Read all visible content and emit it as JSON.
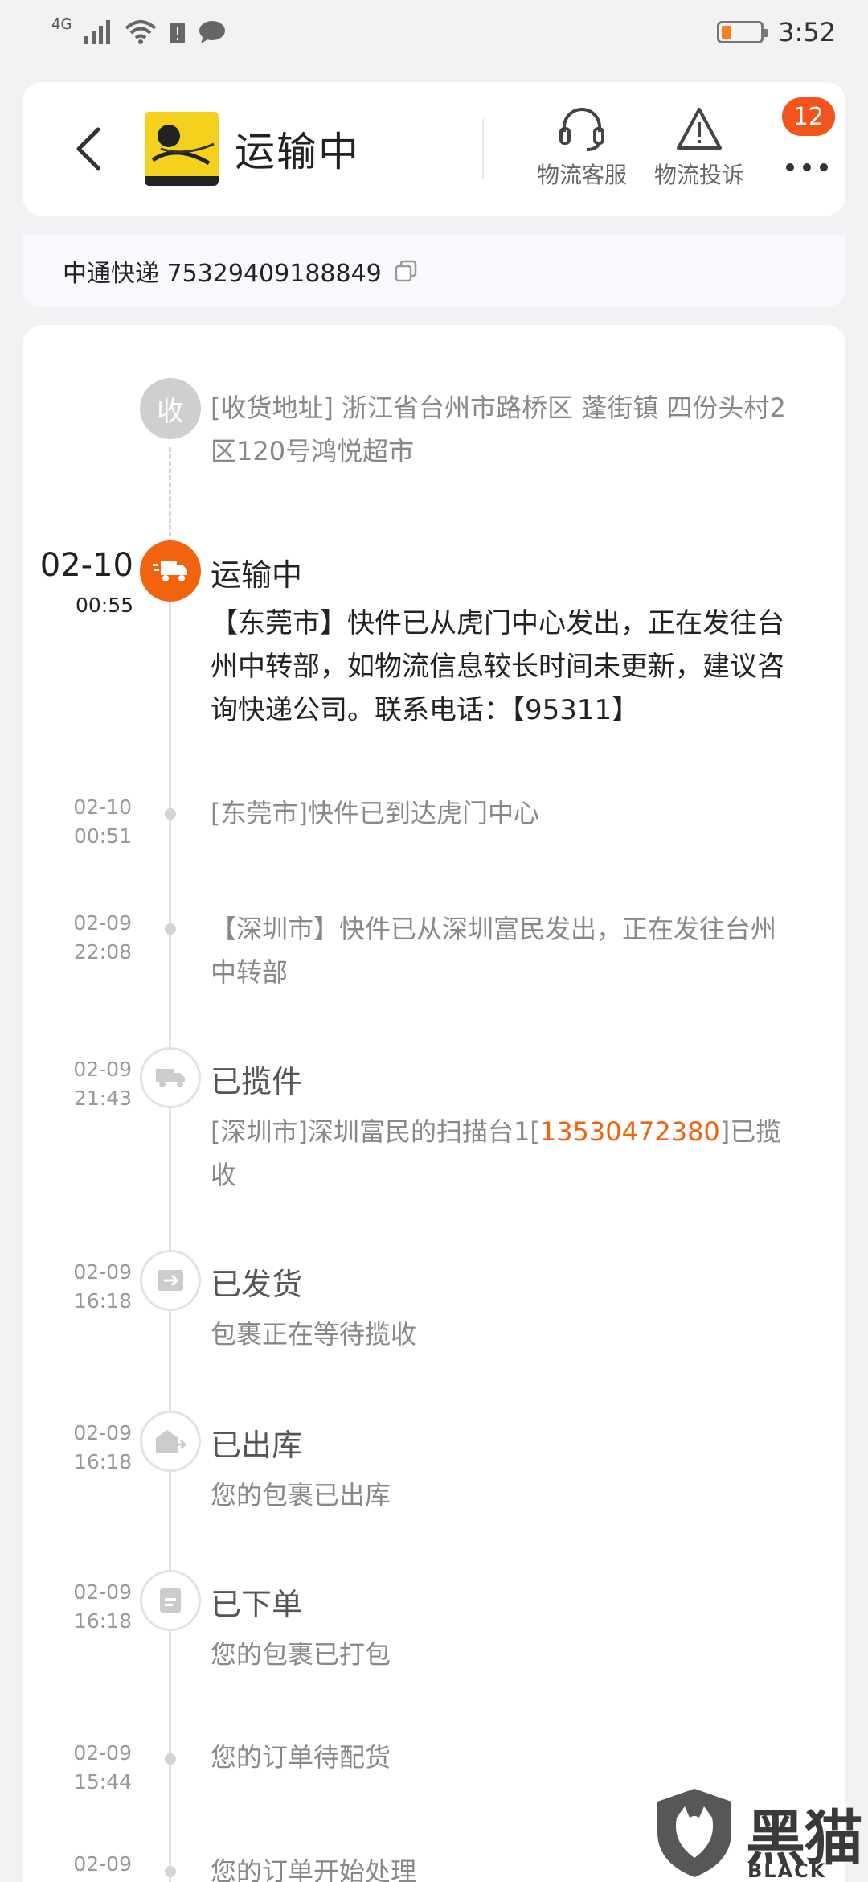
{
  "status_bar": {
    "network": "4G",
    "time": "3:52",
    "battery_level": 0.2
  },
  "header": {
    "title": "运输中",
    "actions": [
      {
        "label": "物流客服",
        "icon": "headset-icon"
      },
      {
        "label": "物流投诉",
        "icon": "warning-icon"
      }
    ],
    "more_badge": "12"
  },
  "courier": {
    "text": "中通快递 75329409188849"
  },
  "timeline": {
    "address": "[收货地址] 浙江省台州市路桥区 蓬街镇   四份头村2区120号鸿悦超市",
    "address_badge": "收",
    "events": [
      {
        "date": "02-10",
        "time": "00:55",
        "title": "运输中",
        "text": "【东莞市】快件已从虎门中心发出，正在发往台州中转部，如物流信息较长时间未更新，建议咨询快递公司。联系电话：【95311】"
      },
      {
        "date": "02-10",
        "time": "00:51",
        "text": "[东莞市]快件已到达虎门中心"
      },
      {
        "date": "02-09",
        "time": "22:08",
        "text": "【深圳市】快件已从深圳富民发出，正在发往台州中转部"
      },
      {
        "date": "02-09",
        "time": "21:43",
        "title": "已揽件",
        "text_before": "[深圳市]深圳富民的扫描台1[",
        "phone": "13530472380",
        "text_after": "]已揽收"
      },
      {
        "date": "02-09",
        "time": "16:18",
        "title": "已发货",
        "text": "包裹正在等待揽收"
      },
      {
        "date": "02-09",
        "time": "16:18",
        "title": "已出库",
        "text": "您的包裹已出库"
      },
      {
        "date": "02-09",
        "time": "16:18",
        "title": "已下单",
        "text": "您的包裹已打包"
      },
      {
        "date": "02-09",
        "time": "15:44",
        "text": "您的订单待配货"
      },
      {
        "date": "02-09",
        "time": "",
        "text": "您的订单开始处理"
      }
    ]
  },
  "watermark": {
    "cn": "黑猫",
    "en": "BLACK CAT"
  },
  "colors": {
    "accent": "#f2630f",
    "badge": "#f2541c"
  }
}
